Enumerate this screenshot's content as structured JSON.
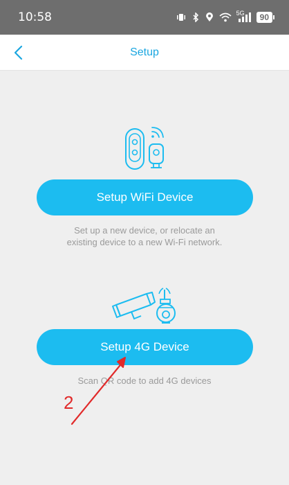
{
  "status_bar": {
    "time": "10:58",
    "network_label": "5G",
    "battery": "90"
  },
  "nav": {
    "title": "Setup"
  },
  "wifi_section": {
    "button_label": "Setup WiFi Device",
    "description": "Set up a new device, or relocate an existing device to a new Wi-Fi network."
  },
  "g4_section": {
    "button_label": "Setup 4G Device",
    "description": "Scan QR code to add 4G devices"
  },
  "annotation": {
    "number": "2",
    "color": "#e12a2a"
  },
  "colors": {
    "accent": "#1cbcf0",
    "title": "#1aa6e0",
    "background": "#efefef"
  }
}
